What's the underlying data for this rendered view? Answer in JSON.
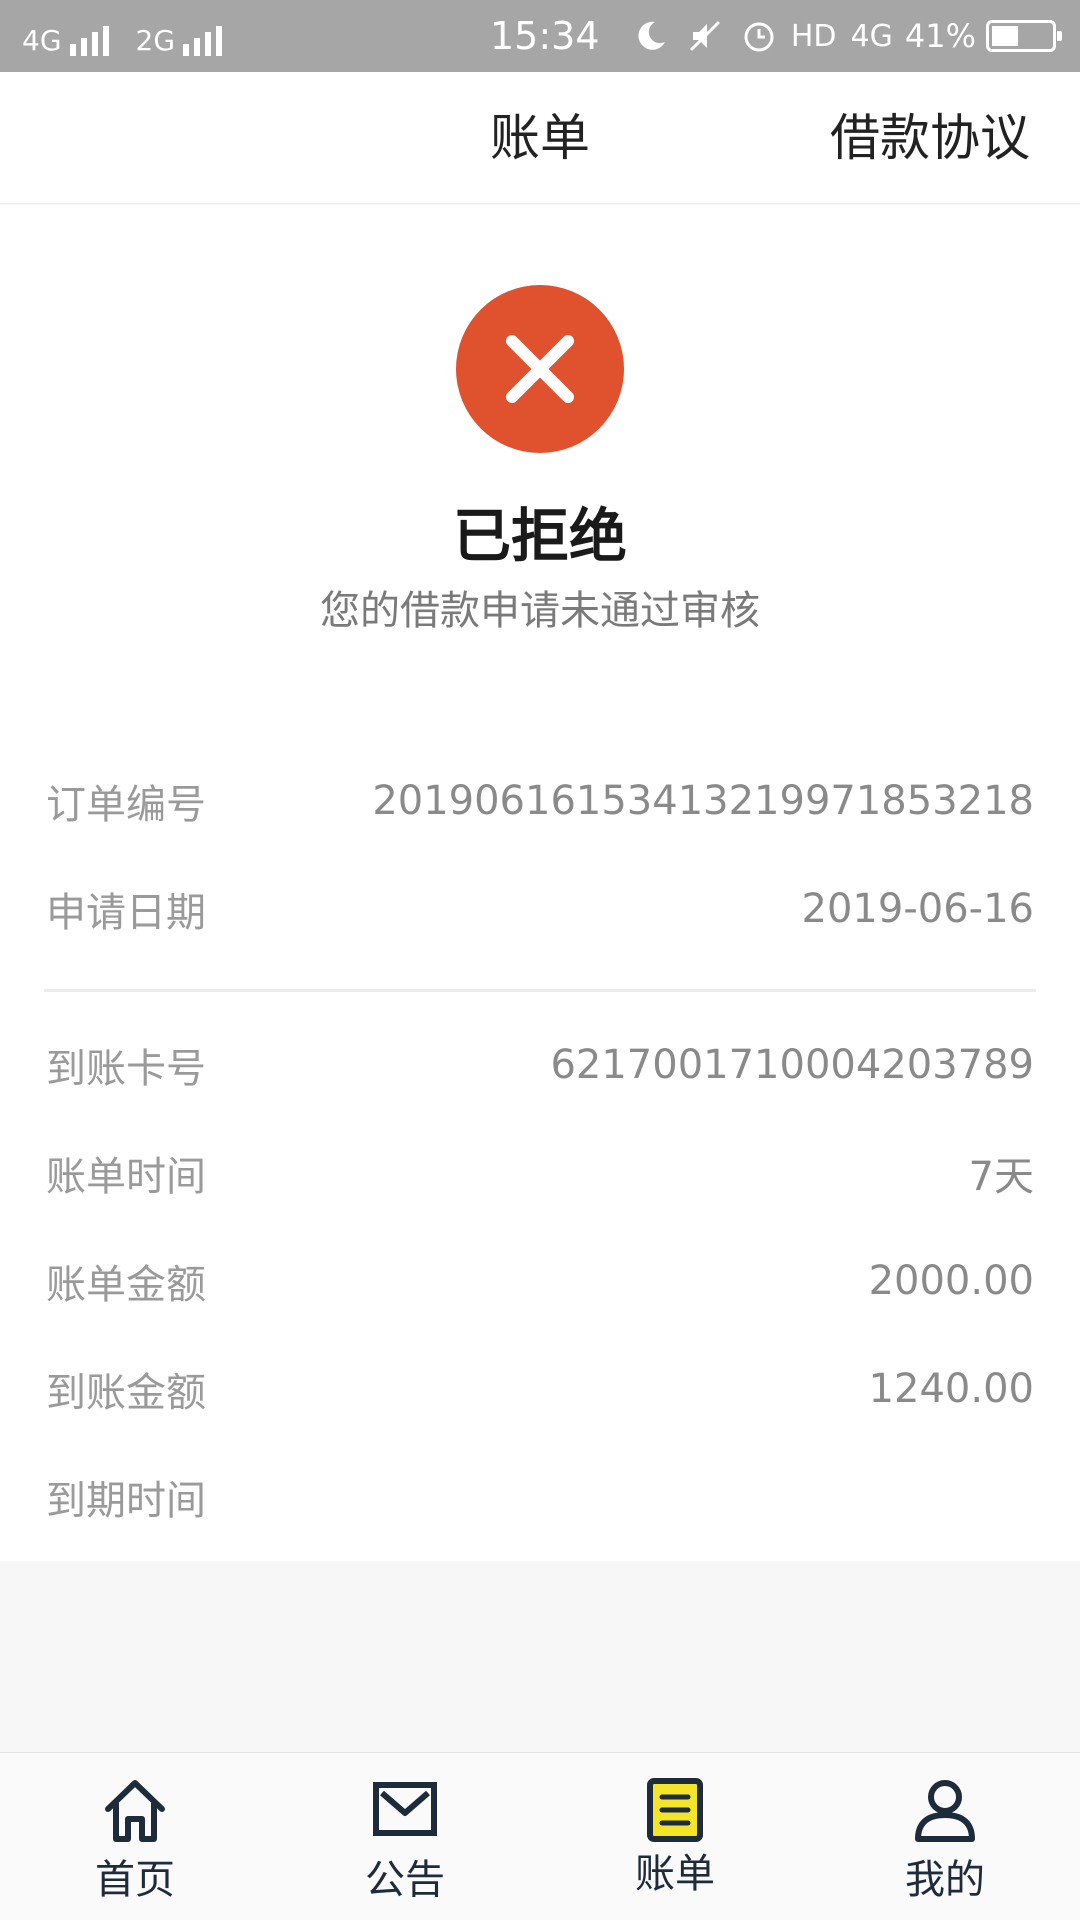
{
  "status_bar": {
    "sim1": "4G",
    "sim2": "2G",
    "time": "15:34",
    "hd": "HD",
    "net": "4G",
    "battery": "41%",
    "battery_level": 0.41
  },
  "header": {
    "title": "账单",
    "right_link": "借款协议"
  },
  "status": {
    "title": "已拒绝",
    "subtitle": "您的借款申请未通过审核",
    "icon": "close-icon",
    "icon_color": "#e0512e"
  },
  "details": {
    "order_no": {
      "label": "订单编号",
      "value": "201906161534132199718532​18"
    },
    "apply_date": {
      "label": "申请日期",
      "value": "2019-06-16"
    },
    "card_no": {
      "label": "到账卡号",
      "value": "6217001710004203789"
    },
    "bill_period": {
      "label": "账单时间",
      "value": "7天"
    },
    "bill_amount": {
      "label": "账单金额",
      "value": "2000.00"
    },
    "received_amount": {
      "label": "到账金额",
      "value": "1240.00"
    },
    "due_time": {
      "label": "到期时间",
      "value": ""
    }
  },
  "nav": {
    "items": [
      {
        "label": "首页",
        "icon": "home-icon"
      },
      {
        "label": "公告",
        "icon": "mail-icon"
      },
      {
        "label": "账单",
        "icon": "bill-icon",
        "active": true
      },
      {
        "label": "我的",
        "icon": "user-icon"
      }
    ],
    "active_highlight": "#f5e52a",
    "icon_color": "#1d2b3a"
  }
}
